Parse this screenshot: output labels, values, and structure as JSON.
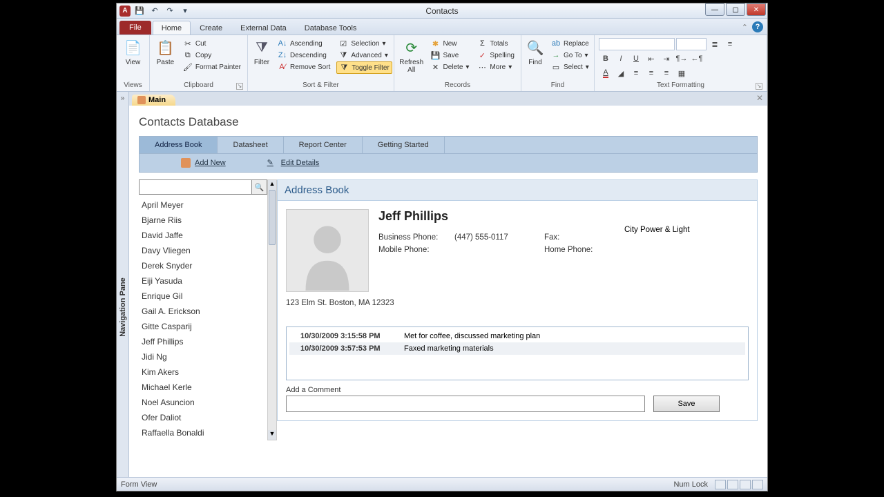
{
  "window": {
    "title": "Contacts"
  },
  "menu": {
    "file": "File",
    "tabs": [
      "Home",
      "Create",
      "External Data",
      "Database Tools"
    ],
    "active": 0
  },
  "ribbon": {
    "views": {
      "view": "View",
      "group": "Views"
    },
    "clipboard": {
      "paste": "Paste",
      "cut": "Cut",
      "copy": "Copy",
      "painter": "Format Painter",
      "group": "Clipboard"
    },
    "sortfilter": {
      "filter": "Filter",
      "asc": "Ascending",
      "desc": "Descending",
      "remove": "Remove Sort",
      "selection": "Selection",
      "advanced": "Advanced",
      "toggle": "Toggle Filter",
      "group": "Sort & Filter"
    },
    "records": {
      "refresh": "Refresh All",
      "new": "New",
      "save": "Save",
      "delete": "Delete",
      "totals": "Totals",
      "spelling": "Spelling",
      "more": "More",
      "group": "Records"
    },
    "find": {
      "find": "Find",
      "replace": "Replace",
      "goto": "Go To",
      "select": "Select",
      "group": "Find"
    },
    "textfmt": {
      "group": "Text Formatting"
    }
  },
  "navpane": {
    "label": "Navigation Pane"
  },
  "doc": {
    "tab": "Main"
  },
  "db": {
    "title": "Contacts Database",
    "tabs": [
      "Address Book",
      "Datasheet",
      "Report Center",
      "Getting Started"
    ],
    "actions": {
      "addnew": "Add New",
      "edit": "Edit Details"
    },
    "search_placeholder": "",
    "names": [
      "April Meyer",
      "Bjarne Riis",
      "David Jaffe",
      "Davy Vliegen",
      "Derek Snyder",
      "Eiji Yasuda",
      "Enrique Gil",
      "Gail A. Erickson",
      "Gitte Casparij",
      "Jeff Phillips",
      "Jidi Ng",
      "Kim Akers",
      "Michael Kerle",
      "Noel Asuncion",
      "Ofer Daliot",
      "Raffaella Bonaldi"
    ],
    "card": {
      "heading": "Address Book",
      "name": "Jeff Phillips",
      "company": "City Power & Light",
      "labels": {
        "bphone": "Business Phone:",
        "mphone": "Mobile Phone:",
        "fax": "Fax:",
        "hphone": "Home Phone:"
      },
      "bphone": "(447) 555-0117",
      "mphone": "",
      "fax": "",
      "hphone": "",
      "address": "123 Elm St. Boston, MA 12323",
      "notes": [
        {
          "ts": "10/30/2009 3:15:58 PM",
          "text": "Met for coffee, discussed marketing plan"
        },
        {
          "ts": "10/30/2009 3:57:53 PM",
          "text": "Faxed marketing materials"
        }
      ],
      "comment_label": "Add a Comment",
      "save": "Save"
    }
  },
  "status": {
    "left": "Form View",
    "numlock": "Num Lock"
  }
}
